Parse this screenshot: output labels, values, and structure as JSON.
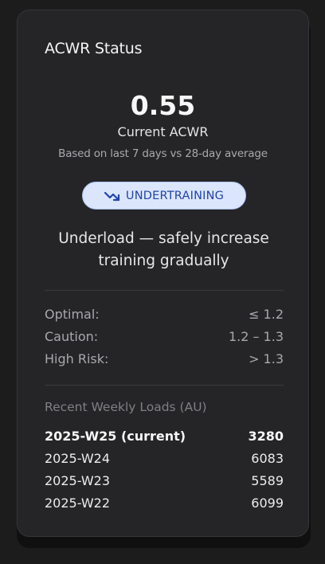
{
  "card": {
    "title": "ACWR Status",
    "value": "0.55",
    "value_label": "Current ACWR",
    "basis": "Based on last 7 days vs 28-day average",
    "status": {
      "label": "UNDERTRAINING",
      "icon": "trend-down-icon",
      "color": "#2244a8",
      "background": "#dbe6fd"
    },
    "message": "Underload — safely increase training gradually",
    "thresholds": [
      {
        "label": "Optimal:",
        "value": "≤ 1.2"
      },
      {
        "label": "Caution:",
        "value": "1.2 – 1.3"
      },
      {
        "label": "High Risk:",
        "value": "> 1.3"
      }
    ],
    "recent_title": "Recent Weekly Loads (AU)",
    "loads": [
      {
        "week": "2025-W25 (current)",
        "value": "3280"
      },
      {
        "week": "2025-W24",
        "value": "6083"
      },
      {
        "week": "2025-W23",
        "value": "5589"
      },
      {
        "week": "2025-W22",
        "value": "6099"
      }
    ]
  }
}
